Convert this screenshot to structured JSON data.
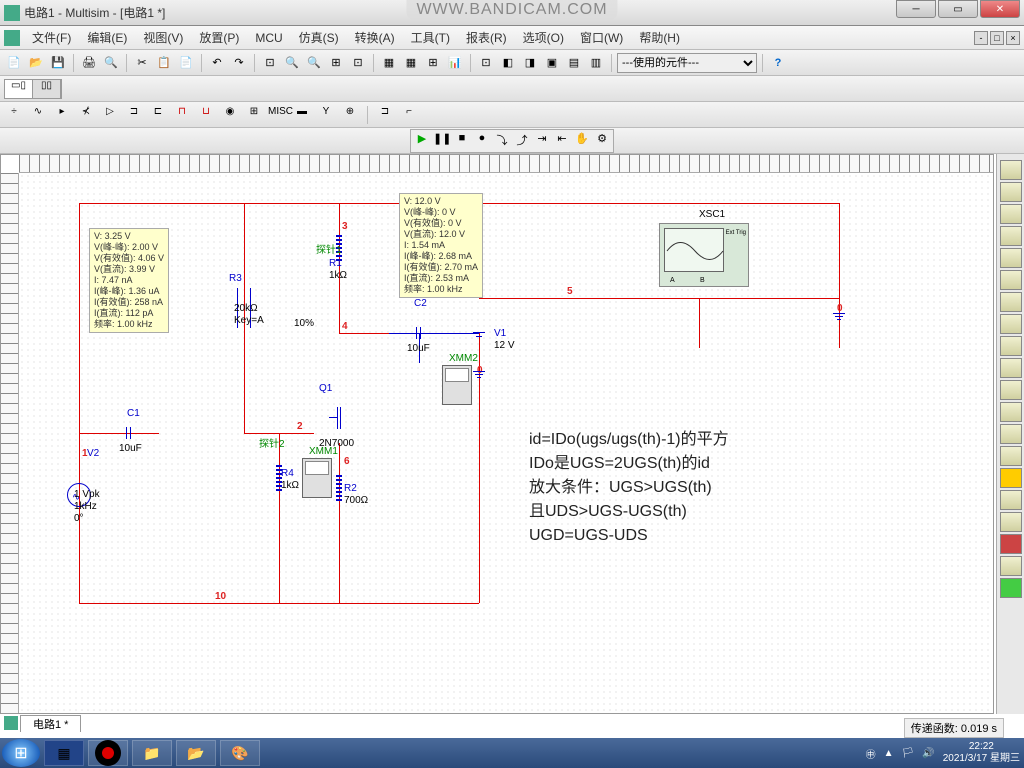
{
  "window": {
    "title": "电路1 - Multisim - [电路1 *]"
  },
  "watermark": "WWW.BANDICAM.COM",
  "menu": {
    "file": "文件(F)",
    "edit": "编辑(E)",
    "view": "视图(V)",
    "place": "放置(P)",
    "mcu": "MCU",
    "sim": "仿真(S)",
    "transfer": "转换(A)",
    "tools": "工具(T)",
    "report": "报表(R)",
    "options": "选项(O)",
    "window": "窗口(W)",
    "help": "帮助(H)"
  },
  "dropdown": {
    "inuse": "---使用的元件---"
  },
  "tooltip1": {
    "l1": "V: 3.25 V",
    "l2": "V(峰-峰): 2.00 V",
    "l3": "V(有效值): 4.06 V",
    "l4": "V(直流): 3.99 V",
    "l5": "I: 7.47 nA",
    "l6": "I(峰-峰): 1.36 uA",
    "l7": "I(有效值): 258 nA",
    "l8": "I(直流): 112 pA",
    "l9": "频率: 1.00 kHz"
  },
  "tooltip2": {
    "l1": "V: 12.0 V",
    "l2": "V(峰-峰): 0 V",
    "l3": "V(有效值): 0 V",
    "l4": "V(直流): 12.0 V",
    "l5": "I: 1.54 mA",
    "l6": "I(峰-峰): 2.68 mA",
    "l7": "I(有效值): 2.70 mA",
    "l8": "I(直流): 2.53 mA",
    "l9": "频率: 1.00 kHz"
  },
  "components": {
    "r1": {
      "name": "R1",
      "value": "1kΩ"
    },
    "r2": {
      "name": "R2",
      "value": "700Ω"
    },
    "r3": {
      "name": "R3",
      "value": "20kΩ",
      "key": "Key=A",
      "pct": "10%"
    },
    "r4": {
      "name": "R4",
      "value": "1kΩ"
    },
    "c1": {
      "name": "C1",
      "value": "10uF"
    },
    "c2": {
      "name": "C2",
      "value": "10uF"
    },
    "v1": {
      "name": "V1",
      "value": "12 V"
    },
    "v2": {
      "name": "V2",
      "l1": "1 Vpk",
      "l2": "1kHz",
      "l3": "0°"
    },
    "q1": {
      "name": "Q1",
      "model": "2N7000"
    },
    "xmm1": "XMM1",
    "xmm2": "XMM2",
    "xsc1": "XSC1",
    "probe1": "探针1",
    "probe2": "探针2"
  },
  "nets": {
    "n1": "1",
    "n2": "2",
    "n3": "3",
    "n4": "4",
    "n5": "5",
    "n6": "6",
    "n10": "10",
    "n0a": "0",
    "n0b": "0"
  },
  "scope": {
    "exttrig": "Ext Trig",
    "a": "A",
    "b": "B"
  },
  "notes": {
    "l1": "id=IDo(ugs/ugs(th)-1)的平方",
    "l2": "IDo是UGS=2UGS(th)的id",
    "l3": "放大条件：UGS>UGS(th)",
    "l4": "且UDS>UGS-UGS(th)",
    "l5": "UGD=UGS-UDS"
  },
  "tab": "电路1 *",
  "status": "传递函数: 0.019 s",
  "clock": {
    "time": "22:22",
    "date": "2021/3/17 星期三"
  }
}
